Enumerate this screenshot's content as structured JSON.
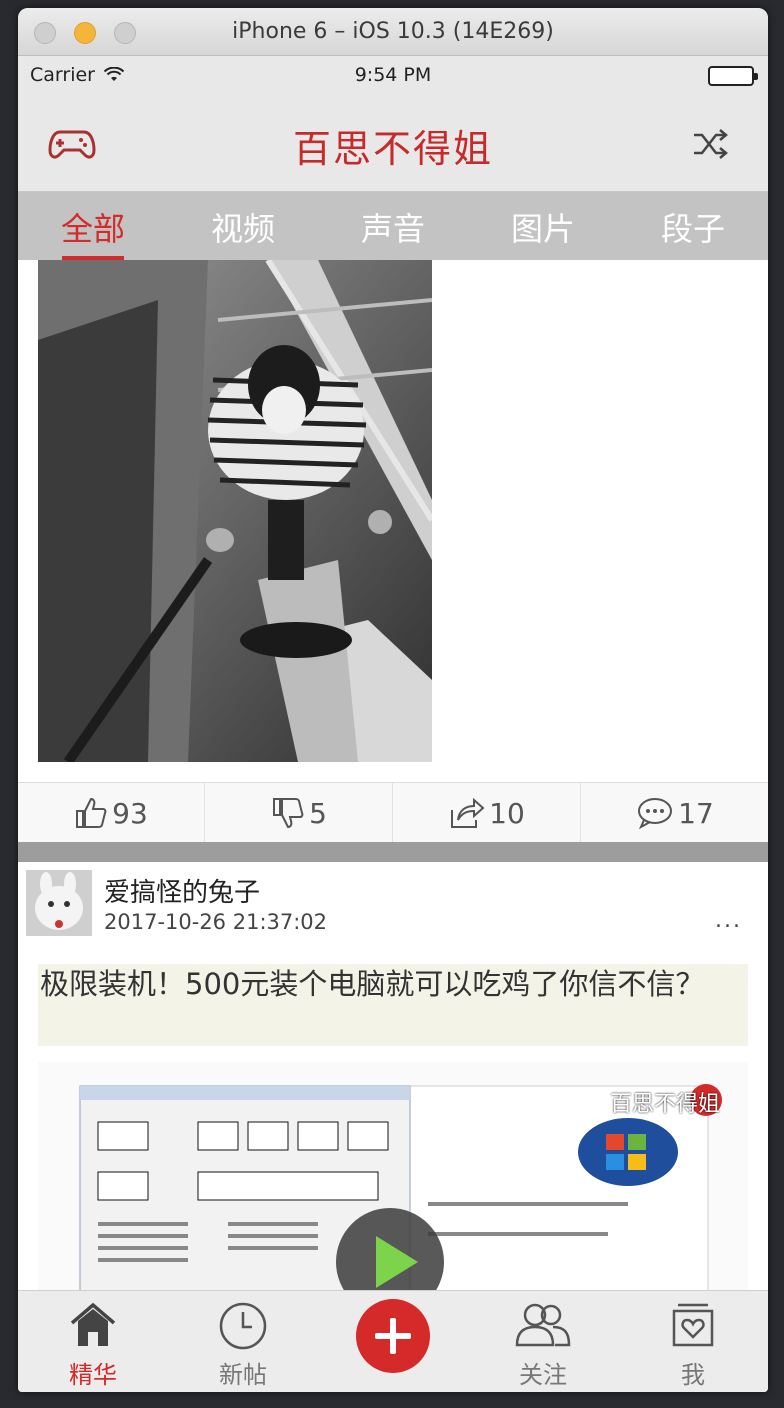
{
  "window": {
    "title": "iPhone 6 – iOS 10.3 (14E269)"
  },
  "status_bar": {
    "carrier": "Carrier",
    "time": "9:54 PM"
  },
  "nav": {
    "title": "百思不得姐",
    "left_icon": "gamepad-icon",
    "right_icon": "shuffle-icon"
  },
  "tabs": [
    {
      "label": "全部",
      "active": true
    },
    {
      "label": "视频",
      "active": false
    },
    {
      "label": "声音",
      "active": false
    },
    {
      "label": "图片",
      "active": false
    },
    {
      "label": "段子",
      "active": false
    }
  ],
  "post1": {
    "actions": [
      {
        "icon": "thumbs-up-icon",
        "count": "93"
      },
      {
        "icon": "thumbs-down-icon",
        "count": "5"
      },
      {
        "icon": "share-icon",
        "count": "10"
      },
      {
        "icon": "comment-icon",
        "count": "17"
      }
    ]
  },
  "post2": {
    "username": "爱搞怪的兔子",
    "time": "2017-10-26 21:37:02",
    "more": "...",
    "text": "极限装机！500元装个电脑就可以吃鸡了你信不信？",
    "video_watermark": "百思不得姐"
  },
  "tabbar": [
    {
      "label": "精华",
      "icon": "home-icon",
      "active": true
    },
    {
      "label": "新帖",
      "icon": "clock-icon",
      "active": false
    },
    {
      "label": "",
      "icon": "publish-plus-icon",
      "active": false
    },
    {
      "label": "关注",
      "icon": "friends-icon",
      "active": false
    },
    {
      "label": "我",
      "icon": "profile-icon",
      "active": false
    }
  ],
  "colors": {
    "accent": "#d42a2a",
    "nav_bg": "#e8e8e8"
  }
}
